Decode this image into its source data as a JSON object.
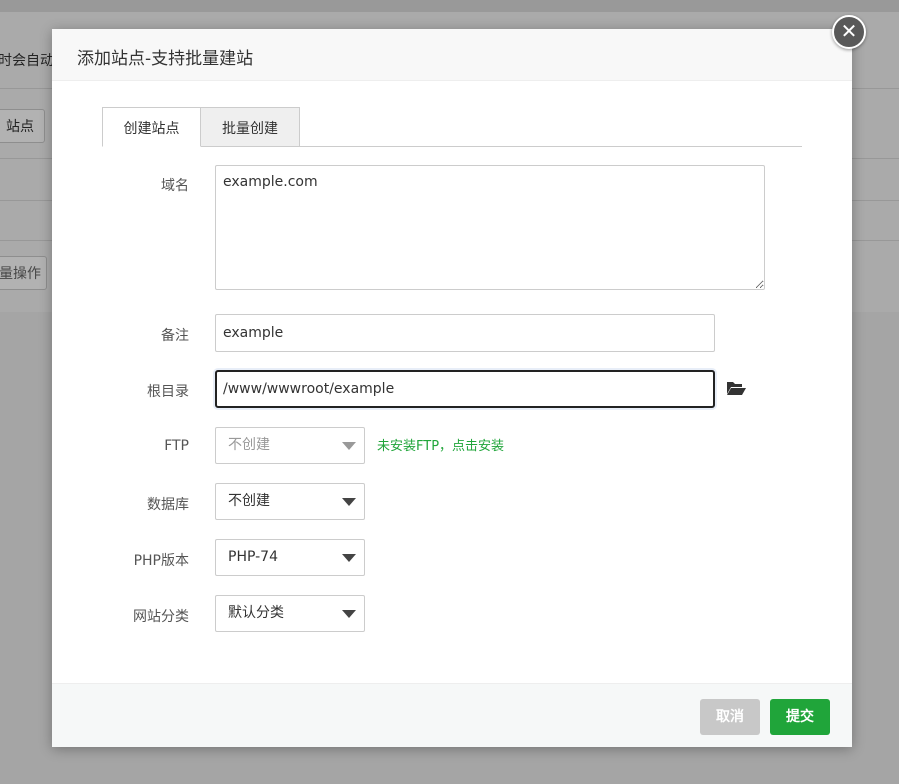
{
  "background": {
    "text_auto": "时会自动创",
    "btn_site": "站点",
    "btn_batch": "量操作"
  },
  "dialog": {
    "title": "添加站点-支持批量建站",
    "close_symbol": "✕"
  },
  "tabs": [
    {
      "label": "创建站点",
      "active": true
    },
    {
      "label": "批量创建",
      "active": false
    }
  ],
  "form": {
    "domain": {
      "label": "域名",
      "value": "example.com"
    },
    "remark": {
      "label": "备注",
      "value": "example"
    },
    "root": {
      "label": "根目录",
      "value": "/www/wwwroot/example",
      "icon": "folder-open-icon"
    },
    "ftp": {
      "label": "FTP",
      "value": "不创建",
      "disabled": true,
      "hint": "未安装FTP，点击安装"
    },
    "database": {
      "label": "数据库",
      "value": "不创建"
    },
    "php": {
      "label": "PHP版本",
      "value": "PHP-74"
    },
    "category": {
      "label": "网站分类",
      "value": "默认分类"
    }
  },
  "footer": {
    "cancel_label": "取消",
    "submit_label": "提交"
  },
  "colors": {
    "accent": "#20a53a",
    "cancel_bg": "#c8c8c8"
  }
}
